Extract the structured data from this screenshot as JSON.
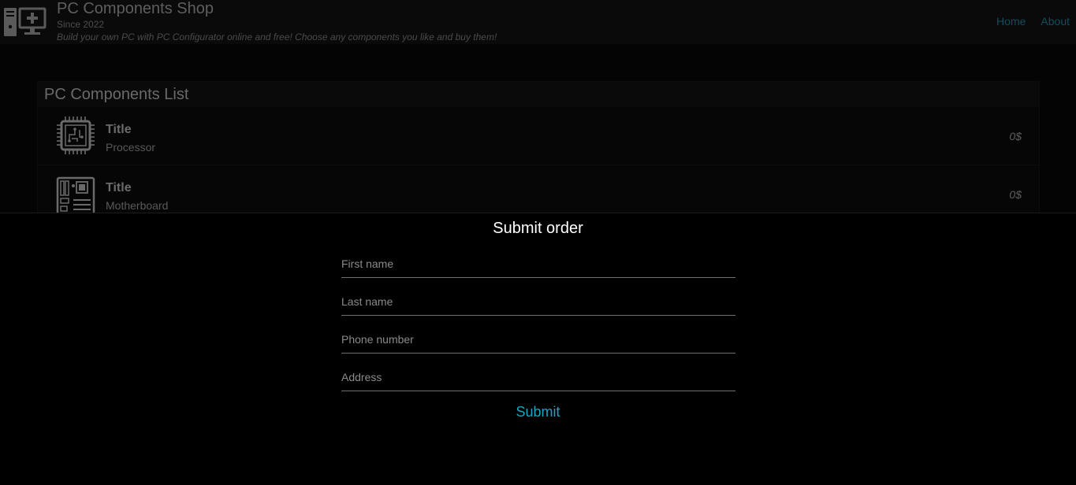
{
  "header": {
    "title": "PC Components Shop",
    "since": "Since 2022",
    "tagline": "Build your own PC with PC Configurator online and free! Choose any components you like and buy them!",
    "logo_icon": "pc-computer-icon",
    "nav": [
      {
        "label": "Home"
      },
      {
        "label": "About"
      }
    ]
  },
  "components": {
    "title": "PC Components List",
    "items": [
      {
        "title": "Title",
        "category": "Processor",
        "price": "0$",
        "icon": "processor-icon"
      },
      {
        "title": "Title",
        "category": "Motherboard",
        "price": "0$",
        "icon": "motherboard-icon"
      }
    ]
  },
  "order": {
    "title": "Submit order",
    "fields": {
      "first_name": {
        "placeholder": "First name",
        "value": ""
      },
      "last_name": {
        "placeholder": "Last name",
        "value": ""
      },
      "phone": {
        "placeholder": "Phone number",
        "value": ""
      },
      "address": {
        "placeholder": "Address",
        "value": ""
      }
    },
    "submit_label": "Submit"
  },
  "colors": {
    "accent": "#19a4c2",
    "nav_link": "#0e4e5c",
    "background": "#000000"
  }
}
